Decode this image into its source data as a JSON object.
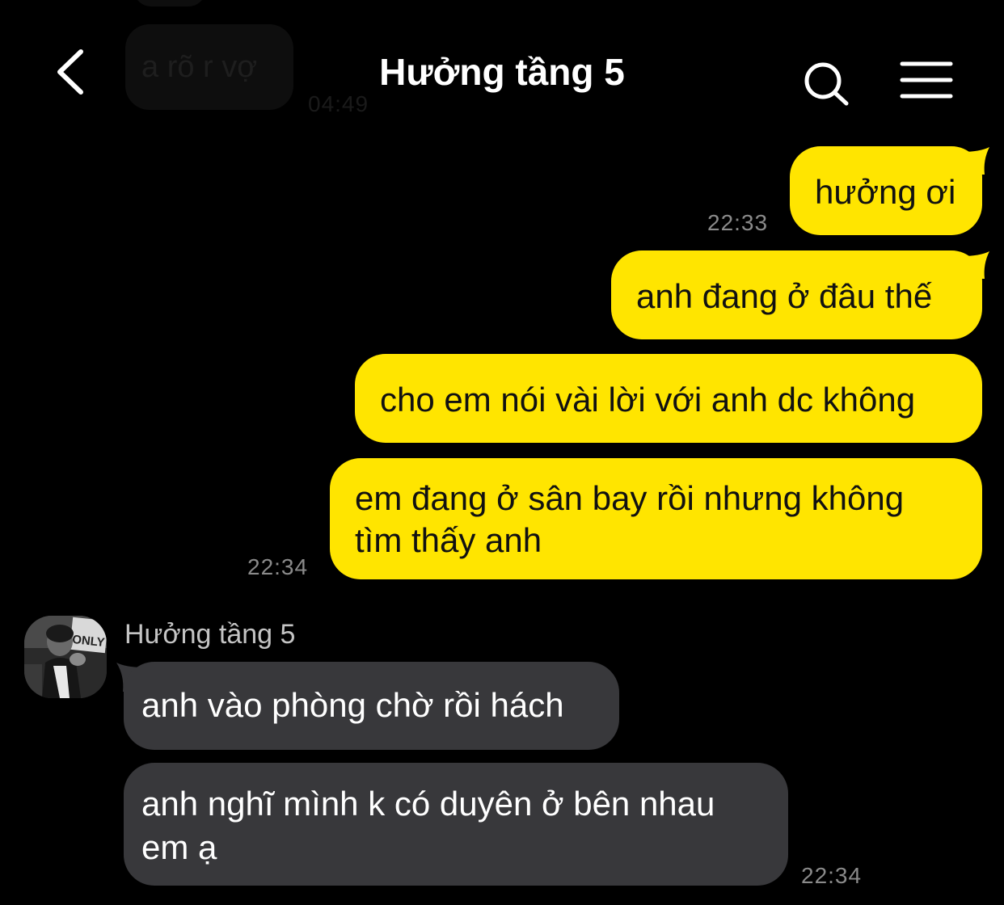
{
  "header": {
    "title": "Hưởng tầng 5"
  },
  "icons": {
    "back": "chevron-left-icon",
    "search": "search-icon",
    "menu": "hamburger-menu-icon"
  },
  "faded_message": {
    "text": "a rõ r vợ",
    "time": "04:49"
  },
  "outgoing": [
    {
      "text": "hưởng ơi",
      "time": "22:33"
    },
    {
      "text": "anh đang ở đâu thế"
    },
    {
      "text": "cho em nói vài lời với anh dc không"
    },
    {
      "line1": "em đang ở sân bay rồi nhưng không",
      "line2": "tìm thấy anh",
      "time": "22:34"
    }
  ],
  "incoming": {
    "sender": "Hưởng tầng 5",
    "avatar_text": "ONLY",
    "messages": [
      {
        "text": "anh vào phòng chờ rồi hách"
      },
      {
        "line1": "anh nghĩ mình k có duyên ở bên nhau",
        "line2": "em ạ",
        "time": "22:34"
      }
    ]
  },
  "colors": {
    "outgoing_bubble": "#ffe500",
    "incoming_bubble": "#38383b",
    "background": "#000000"
  }
}
